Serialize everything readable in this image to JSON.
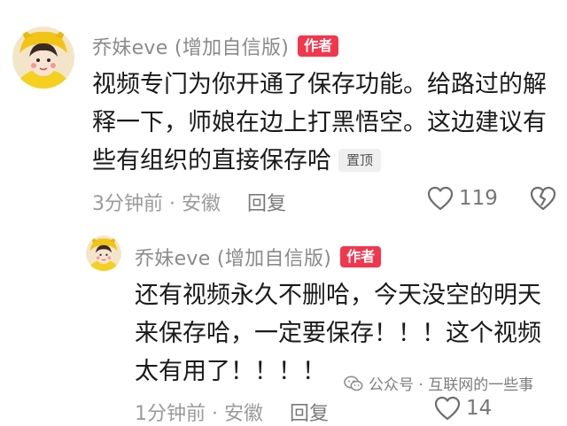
{
  "comment": {
    "username": "乔妹eve (增加自信版)",
    "author_badge": "作者",
    "lines": [
      "视频专门为你开通了保存功能。给路过的解",
      "释一下，师娘在边上打黑悟空。这边建议有",
      "些有组织的直接保存哈"
    ],
    "pin_badge": "置顶",
    "meta": "3分钟前 · 安徽",
    "reply_label": "回复",
    "like_count": "119",
    "like_icon": "heart-outline-icon",
    "dislike_icon": "heart-broken-icon"
  },
  "reply": {
    "username": "乔妹eve (增加自信版)",
    "author_badge": "作者",
    "lines": [
      "还有视频永久不删哈，今天没空的明天",
      "来保存哈，一定要保存！！！这个视频",
      "太有用了！！！！"
    ],
    "meta": "1分钟前 · 安徽",
    "reply_label": "回复",
    "like_count": "14"
  },
  "watermark": {
    "icon": "wechat-icon",
    "text": "公众号 · 互联网的一些事"
  },
  "colors": {
    "author_badge": "#f2374d",
    "username": "#8a8a8a",
    "meta": "#9a9a9a"
  }
}
